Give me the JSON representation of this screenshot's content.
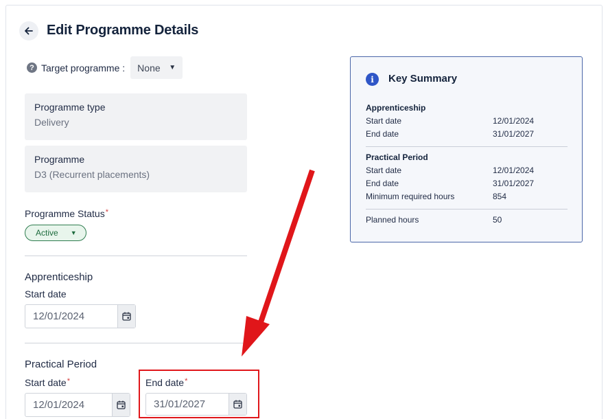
{
  "header": {
    "title": "Edit Programme Details",
    "back_icon": "arrow-left-icon"
  },
  "target_programme": {
    "label": "Target programme :",
    "value": "None"
  },
  "programme_type": {
    "label": "Programme type",
    "value": "Delivery"
  },
  "programme": {
    "label": "Programme",
    "value": "D3 (Recurrent placements)"
  },
  "programme_status": {
    "label": "Programme Status",
    "required": "*",
    "value": "Active",
    "color": "#2f7d4f"
  },
  "apprenticeship": {
    "title": "Apprenticeship",
    "start_label": "Start date",
    "start_value": "12/01/2024"
  },
  "practical_period": {
    "title": "Practical Period",
    "start_label": "Start date",
    "start_required": "*",
    "start_value": "12/01/2024",
    "end_label": "End date",
    "end_required": "*",
    "end_value": "31/01/2027"
  },
  "summary": {
    "title": "Key Summary",
    "accent": "#2f56c7",
    "apprenticeship": {
      "title": "Apprenticeship",
      "rows": [
        {
          "key": "Start date",
          "value": "12/01/2024"
        },
        {
          "key": "End date",
          "value": "31/01/2027"
        }
      ]
    },
    "practical_period": {
      "title": "Practical Period",
      "rows": [
        {
          "key": "Start date",
          "value": "12/01/2024"
        },
        {
          "key": "End date",
          "value": "31/01/2027"
        },
        {
          "key": "Minimum required hours",
          "value": "854"
        }
      ]
    },
    "planned": {
      "key": "Planned hours",
      "value": "50"
    }
  },
  "annotation": {
    "color": "#e0161a"
  }
}
